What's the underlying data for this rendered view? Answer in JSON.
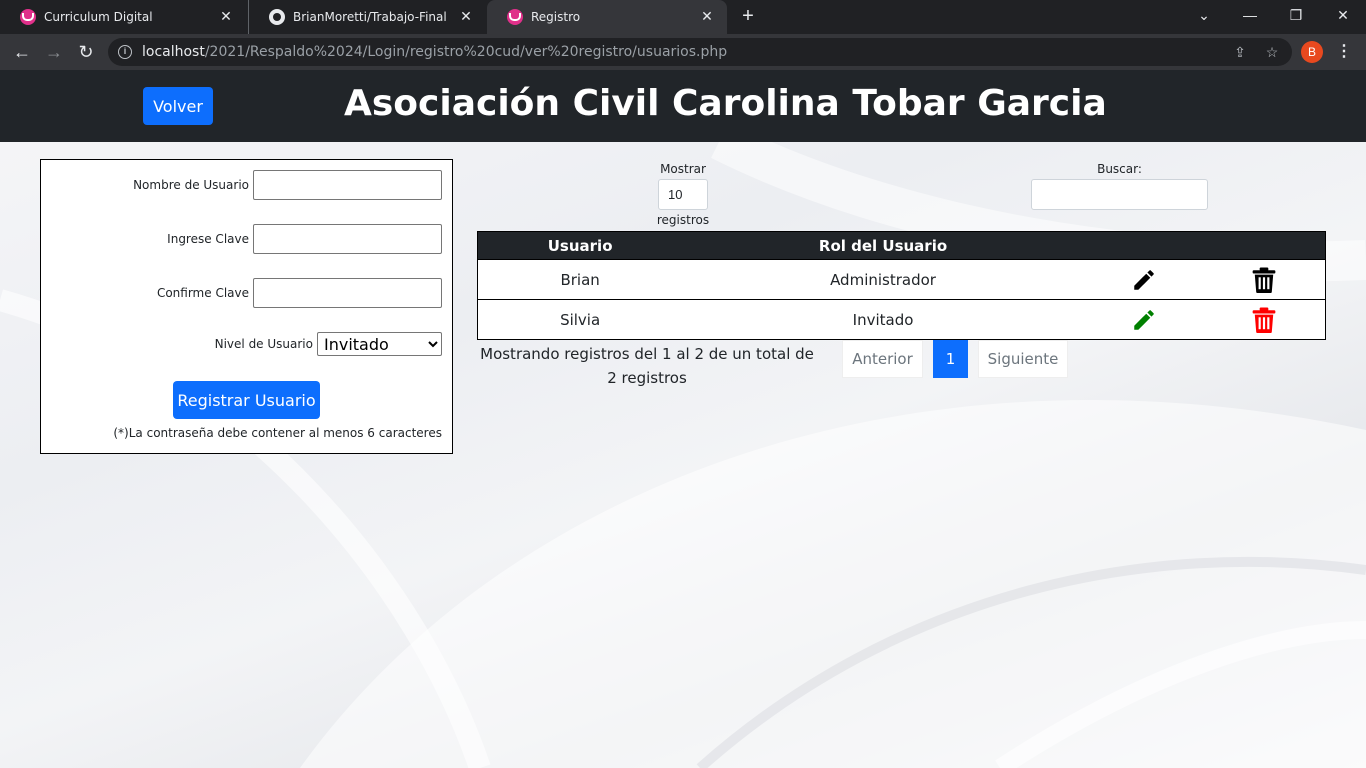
{
  "browser": {
    "tabs": [
      {
        "title": "Curriculum Digital"
      },
      {
        "title": "BrianMoretti/Trabajo-Final"
      },
      {
        "title": "Registro"
      }
    ],
    "url_host": "localhost",
    "url_path": "/2021/Respaldo%2024/Login/registro%20cud/ver%20registro/usuarios.php",
    "profile_initial": "B"
  },
  "header": {
    "back_label": "Volver",
    "title": "Asociación Civil Carolina Tobar Garcia"
  },
  "form": {
    "username_label": "Nombre de Usuario",
    "password_label": "Ingrese Clave",
    "confirm_label": "Confirme Clave",
    "level_label": "Nivel de Usuario",
    "level_selected": "Invitado",
    "submit_label": "Registrar Usuario",
    "note": "(*)La contraseña debe contener al menos 6 caracteres"
  },
  "list_controls": {
    "show_label": "Mostrar",
    "show_value": "10",
    "show_suffix": "registros",
    "search_label": "Buscar:"
  },
  "table": {
    "headers": [
      "Usuario",
      "Rol del Usuario",
      "",
      ""
    ],
    "rows": [
      {
        "user": "Brian",
        "role": "Administrador",
        "edit_color": "#000000",
        "delete_color": "#000000"
      },
      {
        "user": "Silvia",
        "role": "Invitado",
        "edit_color": "#008000",
        "delete_color": "#ff0000"
      }
    ]
  },
  "footer": {
    "info": "Mostrando registros del 1 al 2 de un total de 2 registros",
    "prev_label": "Anterior",
    "current_page": "1",
    "next_label": "Siguiente"
  },
  "colors": {
    "primary": "#0d6efd",
    "header_bg": "#212529"
  }
}
